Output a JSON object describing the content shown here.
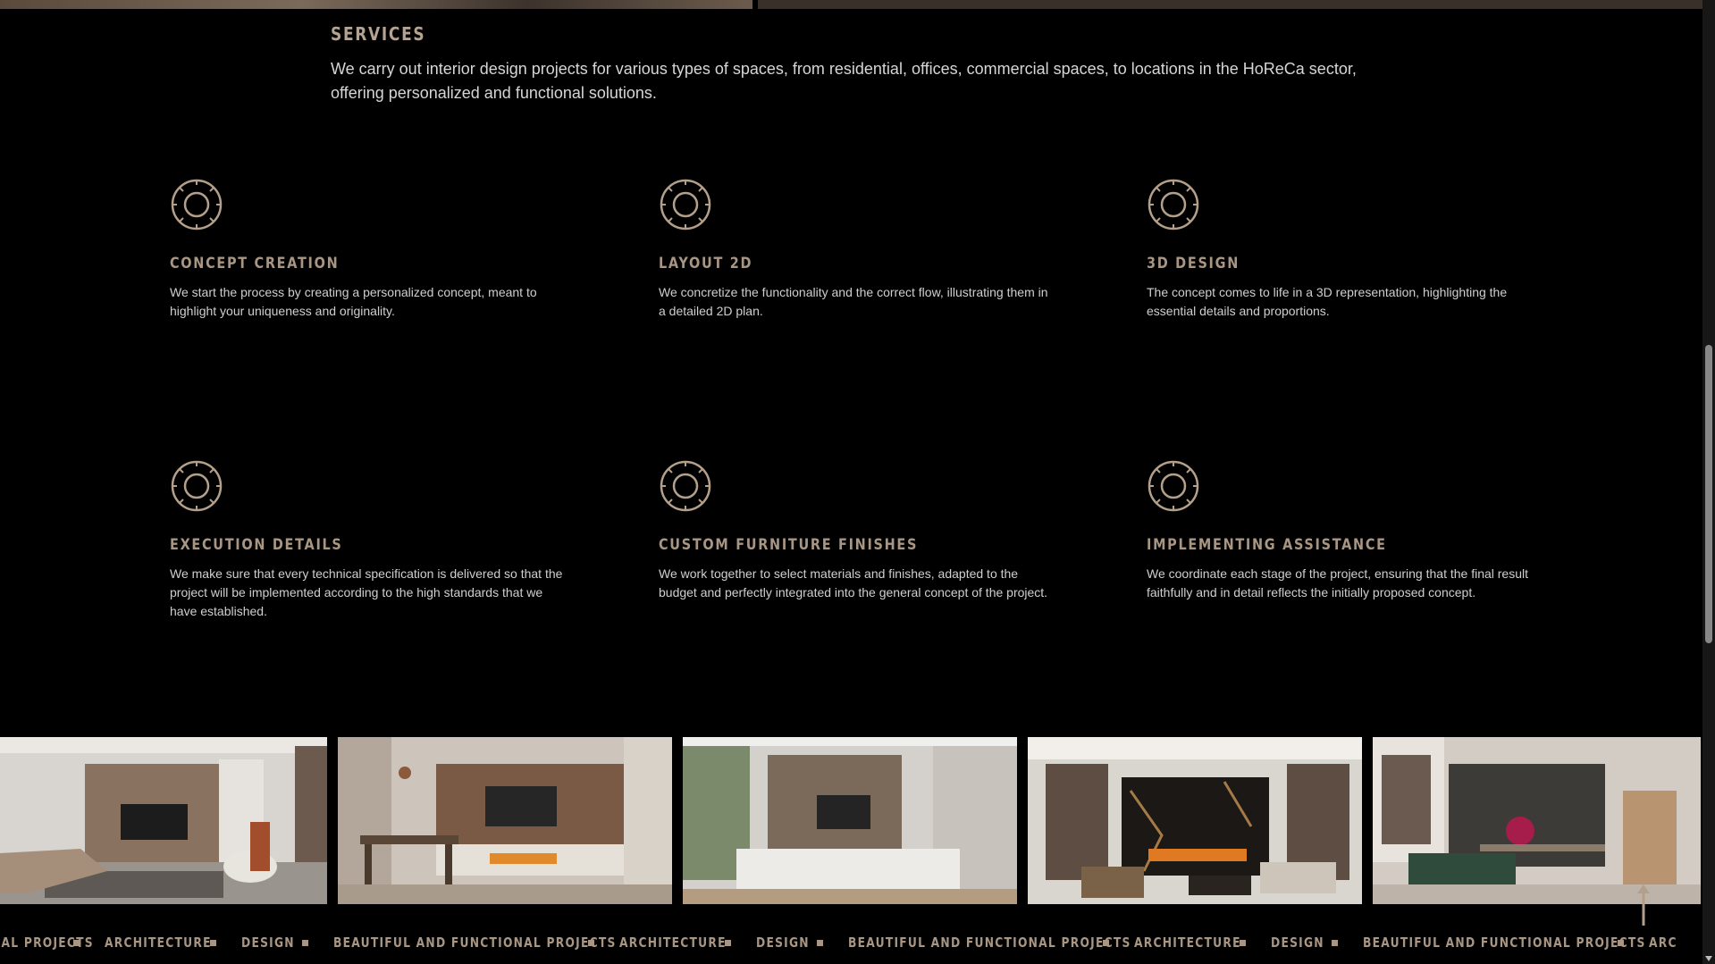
{
  "services": {
    "title": "SERVICES",
    "description": "We carry out interior design projects for various types of spaces, from residential, offices, commercial spaces, to locations in the HoReCa sector, offering personalized and functional solutions.",
    "items": [
      {
        "title": "CONCEPT CREATION",
        "text": "We start the process by creating a personalized concept, meant to highlight your uniqueness and originality."
      },
      {
        "title": "LAYOUT 2D",
        "text": "We concretize the functionality and the correct flow, illustrating them in a detailed 2D plan."
      },
      {
        "title": "3D DESIGN",
        "text": "The concept comes to life in a 3D representation, highlighting the essential details and proportions."
      },
      {
        "title": "EXECUTION DETAILS",
        "text": "We make sure that every technical specification is delivered so that the project will be implemented according to the high standards that we have established."
      },
      {
        "title": "CUSTOM FURNITURE FINISHES",
        "text": "We work together to select materials and finishes, adapted to the budget and perfectly integrated into the general concept of the project."
      },
      {
        "title": "IMPLEMENTING ASSISTANCE",
        "text": "We coordinate each stage of the project, ensuring that the final result faithfully and in detail reflects the initially proposed concept."
      }
    ],
    "icon": "ring-icon"
  },
  "marquee": {
    "words": [
      "NAL PROJECTS",
      "ARCHITECTURE",
      "DESIGN",
      "BEAUTIFUL AND FUNCTIONAL PROJECTS",
      "ARCHITECTURE",
      "DESIGN",
      "BEAUTIFUL AND FUNCTIONAL PROJECTS",
      "ARCHITECTURE",
      "DESIGN",
      "BEAUTIFUL AND FUNCTIONAL PROJECTS",
      "ARC"
    ]
  },
  "colors": {
    "accent": "#a89683",
    "background": "#000000"
  }
}
